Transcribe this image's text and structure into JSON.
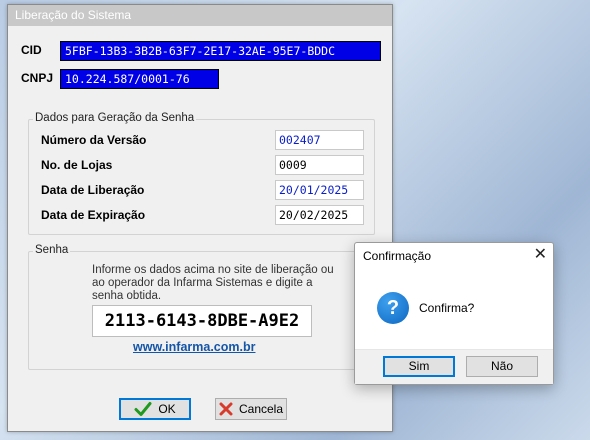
{
  "window": {
    "title": "Liberação do Sistema",
    "cid_label": "CID",
    "cid_value": "5FBF-13B3-3B2B-63F7-2E17-32AE-95E7-BDDC",
    "cnpj_label": "CNPJ",
    "cnpj_value": "10.224.587/0001-76"
  },
  "dados": {
    "legend": "Dados para Geração da Senha",
    "versao_label": "Número da Versão",
    "versao_value": "002407",
    "lojas_label": "No. de Lojas",
    "lojas_value": "0009",
    "liberacao_label": "Data de Liberação",
    "liberacao_value": "20/01/2025",
    "expiracao_label": "Data de Expiração",
    "expiracao_value": "20/02/2025"
  },
  "senha": {
    "legend": "Senha",
    "info_line1": "Informe os dados acima no site de liberação ou",
    "info_line2": "ao operador da Infarma Sistemas e digite a",
    "info_line3": "senha obtida.",
    "password": "2113-6143-8DBE-A9E2",
    "link": "www.infarma.com.br"
  },
  "buttons": {
    "ok_label": "OK",
    "cancel_label": "Cancela"
  },
  "dialog": {
    "title": "Confirmação",
    "close_glyph": "✕",
    "icon_glyph": "?",
    "message": "Confirma?",
    "yes_label": "Sim",
    "no_label": "Não"
  },
  "colors": {
    "selection": "#0000e6",
    "field_blue_text": "#0a1ec8",
    "link": "#1455a8",
    "ok_check": "#1f9a1f",
    "cancel_x": "#d83a2c",
    "focus": "#0078d7"
  }
}
